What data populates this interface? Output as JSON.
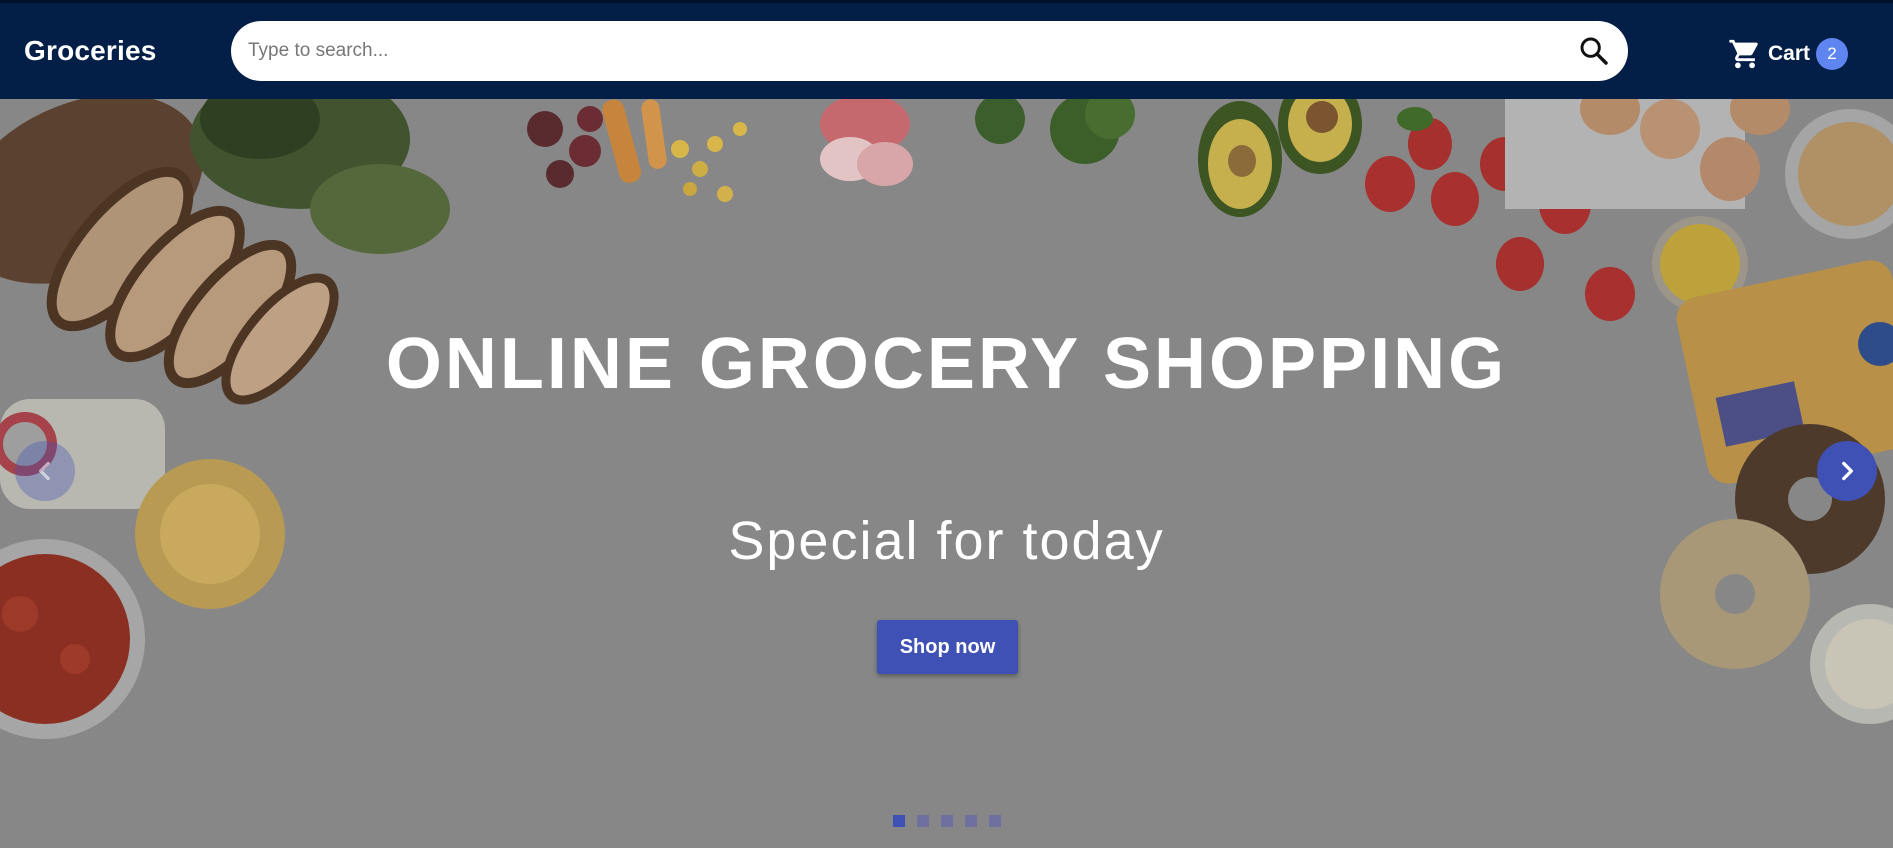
{
  "header": {
    "brand": "Groceries",
    "search": {
      "placeholder": "Type to search...",
      "value": "",
      "button_icon": "search-icon"
    },
    "cart": {
      "icon": "shopping-cart-icon",
      "label": "Cart",
      "count": "2"
    }
  },
  "hero": {
    "title": "ONLINE GROCERY SHOPPING",
    "subtitle": "Special for today",
    "cta_label": "Shop now",
    "prev_icon": "chevron-left-icon",
    "next_icon": "chevron-right-icon",
    "slide_count": 5,
    "active_slide": 1
  },
  "colors": {
    "header_bg": "#041f47",
    "accent": "#3f51b5",
    "badge": "#5f86f0",
    "overlay": "#878787"
  }
}
